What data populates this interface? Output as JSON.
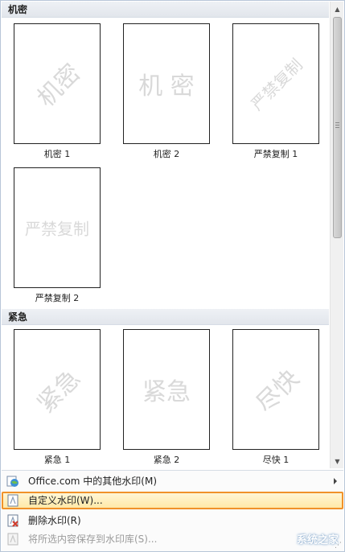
{
  "gallery": {
    "sections": [
      {
        "title": "机密",
        "items": [
          {
            "caption": "机密 1",
            "watermark": "机密",
            "style": "diagonal"
          },
          {
            "caption": "机密 2",
            "watermark": "机 密",
            "style": "horizontal"
          },
          {
            "caption": "严禁复制 1",
            "watermark": "严禁复制",
            "style": "diagonal"
          },
          {
            "caption": "严禁复制 2",
            "watermark": "严禁复制",
            "style": "horizontal"
          }
        ]
      },
      {
        "title": "紧急",
        "items": [
          {
            "caption": "紧急 1",
            "watermark": "紧急",
            "style": "diagonal"
          },
          {
            "caption": "紧急 2",
            "watermark": "紧急",
            "style": "horizontal"
          },
          {
            "caption": "尽快 1",
            "watermark": "尽快",
            "style": "diagonal"
          }
        ]
      }
    ]
  },
  "menu": {
    "office_more": "Office.com 中的其他水印(M)",
    "custom": "自定义水印(W)...",
    "remove": "删除水印(R)",
    "save_selection": "将所选内容保存到水印库(S)..."
  },
  "site_watermark": "系统之家",
  "colors": {
    "highlight_border": "#f0922a",
    "highlight_fill": "#ffe9a8",
    "section_header": "#e7eaef"
  }
}
